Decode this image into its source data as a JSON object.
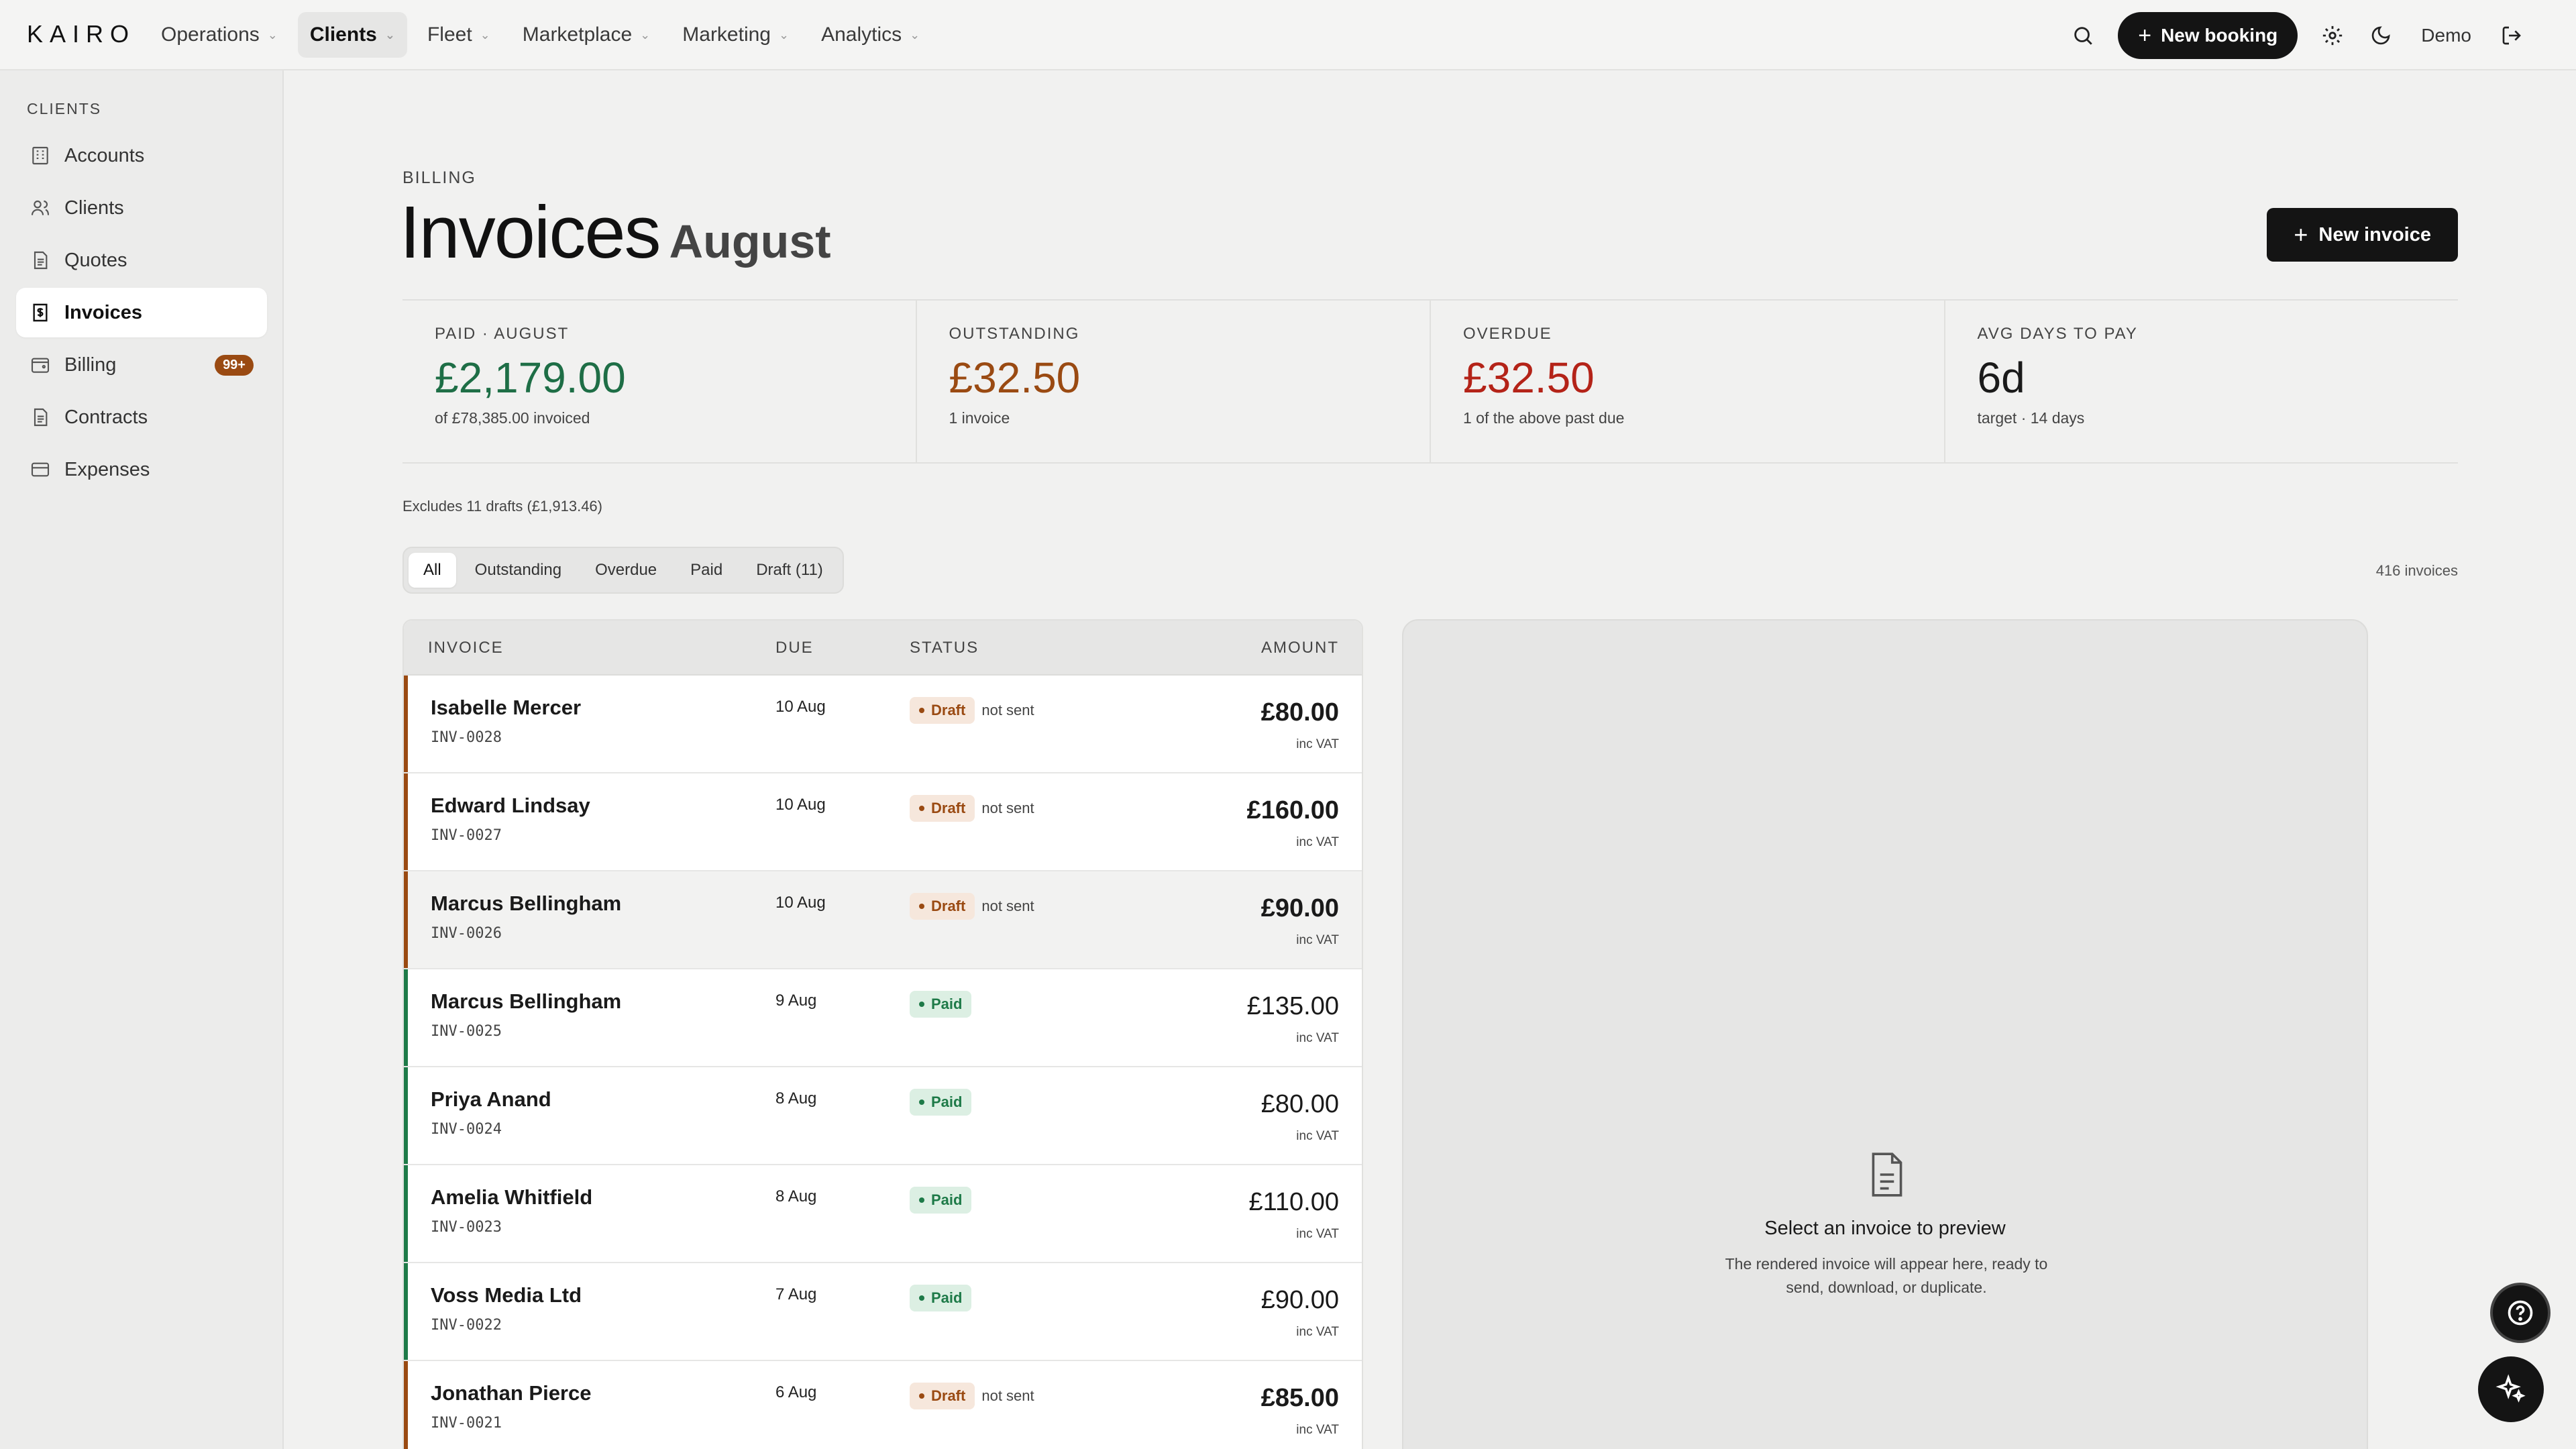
{
  "app": {
    "logo": "KAIRO"
  },
  "nav": [
    {
      "label": "Operations"
    },
    {
      "label": "Clients"
    },
    {
      "label": "Fleet"
    },
    {
      "label": "Marketplace"
    },
    {
      "label": "Marketing"
    },
    {
      "label": "Analytics"
    }
  ],
  "topbar": {
    "new_booking": "New booking",
    "user": "Demo"
  },
  "sidebar": {
    "heading": "CLIENTS",
    "items": [
      {
        "label": "Accounts",
        "icon": "building-icon"
      },
      {
        "label": "Clients",
        "icon": "users-icon"
      },
      {
        "label": "Quotes",
        "icon": "document-icon"
      },
      {
        "label": "Invoices",
        "icon": "receipt-icon"
      },
      {
        "label": "Billing",
        "icon": "wallet-icon",
        "badge": "99+"
      },
      {
        "label": "Contracts",
        "icon": "document-icon"
      },
      {
        "label": "Expenses",
        "icon": "card-icon"
      }
    ],
    "active_index": 3
  },
  "page": {
    "eyebrow": "BILLING",
    "title": "Invoices",
    "subtitle": "August",
    "new_invoice": "New invoice"
  },
  "stats": [
    {
      "label": "PAID · AUGUST",
      "value": "£2,179.00",
      "sub": "of £78,385.00 invoiced",
      "color": "#1e6e46"
    },
    {
      "label": "OUTSTANDING",
      "value": "£32.50",
      "sub": "1 invoice",
      "color": "#9a4a12"
    },
    {
      "label": "OVERDUE",
      "value": "£32.50",
      "sub": "1 of the above past due",
      "color": "#b42318"
    },
    {
      "label": "AVG DAYS TO PAY",
      "value": "6d",
      "sub": "target · 14 days",
      "color": "#1a1a1a"
    }
  ],
  "excludes_note": "Excludes 11 drafts (£1,913.46)",
  "filters": {
    "tabs": [
      "All",
      "Outstanding",
      "Overdue",
      "Paid",
      "Draft (11)"
    ],
    "active": 0,
    "count": "416 invoices"
  },
  "table": {
    "headers": {
      "invoice": "INVOICE",
      "due": "DUE",
      "status": "STATUS",
      "amount": "AMOUNT"
    },
    "rows": [
      {
        "client": "Isabelle Mercer",
        "number": "INV-0028",
        "due": "10 Aug",
        "status": "Draft",
        "note": "not sent",
        "amount": "£80.00",
        "vat": "inc VAT"
      },
      {
        "client": "Edward Lindsay",
        "number": "INV-0027",
        "due": "10 Aug",
        "status": "Draft",
        "note": "not sent",
        "amount": "£160.00",
        "vat": "inc VAT"
      },
      {
        "client": "Marcus Bellingham",
        "number": "INV-0026",
        "due": "10 Aug",
        "status": "Draft",
        "note": "not sent",
        "amount": "£90.00",
        "vat": "inc VAT"
      },
      {
        "client": "Marcus Bellingham",
        "number": "INV-0025",
        "due": "9 Aug",
        "status": "Paid",
        "note": "",
        "amount": "£135.00",
        "vat": "inc VAT"
      },
      {
        "client": "Priya Anand",
        "number": "INV-0024",
        "due": "8 Aug",
        "status": "Paid",
        "note": "",
        "amount": "£80.00",
        "vat": "inc VAT"
      },
      {
        "client": "Amelia Whitfield",
        "number": "INV-0023",
        "due": "8 Aug",
        "status": "Paid",
        "note": "",
        "amount": "£110.00",
        "vat": "inc VAT"
      },
      {
        "client": "Voss Media Ltd",
        "number": "INV-0022",
        "due": "7 Aug",
        "status": "Paid",
        "note": "",
        "amount": "£90.00",
        "vat": "inc VAT"
      },
      {
        "client": "Jonathan Pierce",
        "number": "INV-0021",
        "due": "6 Aug",
        "status": "Draft",
        "note": "not sent",
        "amount": "£85.00",
        "vat": "inc VAT"
      }
    ]
  },
  "preview": {
    "title": "Select an invoice to preview",
    "text": "The rendered invoice will appear here, ready to send, download, or duplicate."
  },
  "colors": {
    "draft": "#9a4a12",
    "paid": "#1e7a48",
    "accent_dark": "#141414"
  }
}
